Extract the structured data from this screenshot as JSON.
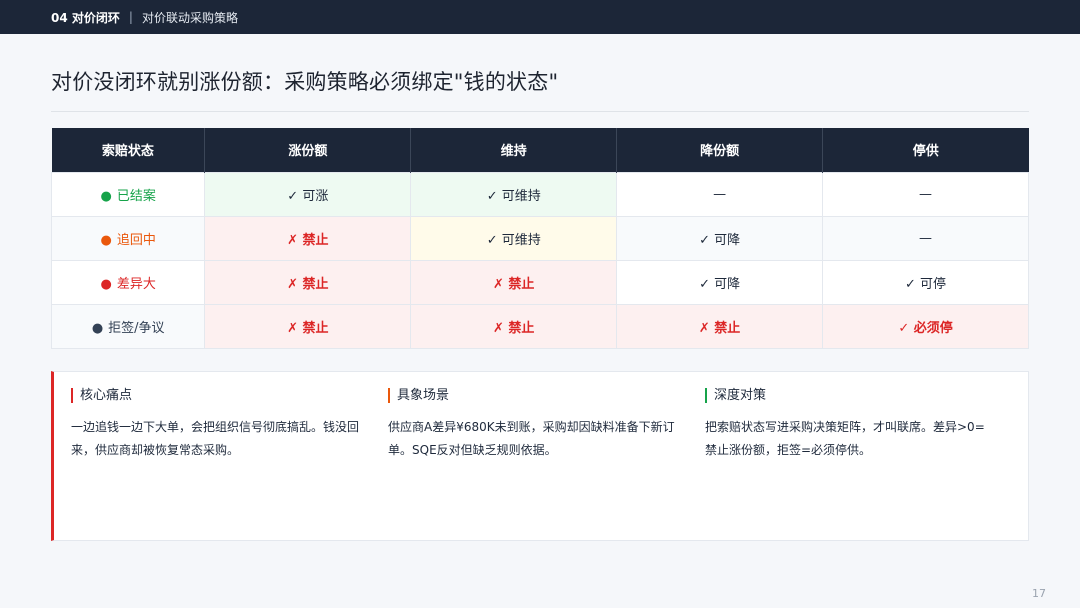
{
  "header": {
    "section": "04 对价闭环",
    "separator": "|",
    "subtitle": "对价联动采购策略"
  },
  "title": "对价没闭环就别涨份额：采购策略必须绑定\"钱的状态\"",
  "table": {
    "columns": [
      "索赔状态",
      "涨份额",
      "维持",
      "降份额",
      "停供"
    ],
    "rows": [
      {
        "status_icon": "●",
        "status": "已结案",
        "status_color": "#16a34a",
        "cells": [
          {
            "text": "✓ 可涨",
            "kind": "allow"
          },
          {
            "text": "✓ 可维持",
            "kind": "allow"
          },
          {
            "text": "—",
            "kind": "none"
          },
          {
            "text": "—",
            "kind": "none"
          }
        ]
      },
      {
        "status_icon": "●",
        "status": "追回中",
        "status_color": "#ea580c",
        "cells": [
          {
            "text": "✗ 禁止",
            "kind": "deny"
          },
          {
            "text": "✓ 可维持",
            "kind": "keep-warn"
          },
          {
            "text": "✓ 可降",
            "kind": "plain"
          },
          {
            "text": "—",
            "kind": "none"
          }
        ]
      },
      {
        "status_icon": "●",
        "status": "差异大",
        "status_color": "#dc2626",
        "cells": [
          {
            "text": "✗ 禁止",
            "kind": "deny"
          },
          {
            "text": "✗ 禁止",
            "kind": "deny"
          },
          {
            "text": "✓ 可降",
            "kind": "plain"
          },
          {
            "text": "✓ 可停",
            "kind": "plain"
          }
        ]
      },
      {
        "status_icon": "●",
        "status": "拒签/争议",
        "status_color": "#334155",
        "cells": [
          {
            "text": "✗ 禁止",
            "kind": "deny"
          },
          {
            "text": "✗ 禁止",
            "kind": "deny"
          },
          {
            "text": "✗ 禁止",
            "kind": "deny"
          },
          {
            "text": "✓ 必须停",
            "kind": "must"
          }
        ]
      }
    ]
  },
  "panel": {
    "accent": "#dc2626",
    "columns": [
      {
        "heading": "核心痛点",
        "color": "#dc2626",
        "text": "一边追钱一边下大单，会把组织信号彻底搞乱。钱没回来，供应商却被恢复常态采购。"
      },
      {
        "heading": "具象场景",
        "color": "#ea580c",
        "text": "供应商A差异¥680K未到账，采购却因缺料准备下新订单。SQE反对但缺乏规则依据。"
      },
      {
        "heading": "深度对策",
        "color": "#16a34a",
        "text": "把索赔状态写进采购决策矩阵，才叫联席。差异>0=禁止涨份额，拒签=必须停供。"
      }
    ]
  },
  "page_number": "17"
}
